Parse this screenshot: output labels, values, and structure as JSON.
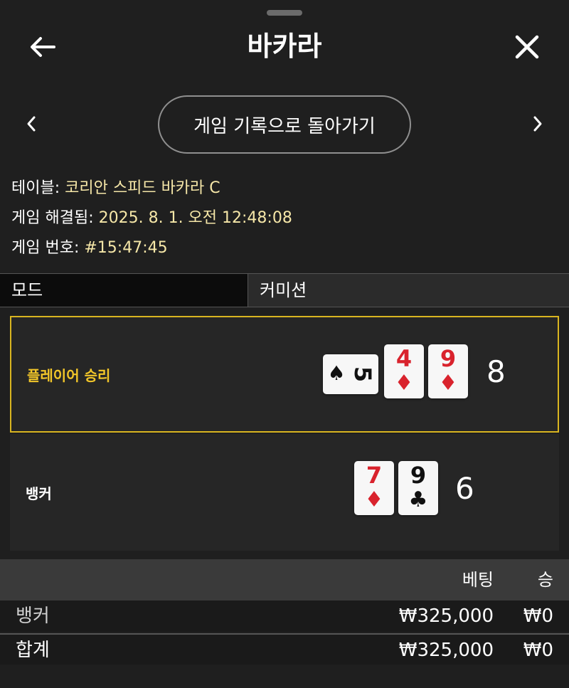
{
  "header": {
    "title": "바카라",
    "back_icon": "arrow-left-icon",
    "close_icon": "close-icon"
  },
  "nav": {
    "back_history_label": "게임 기록으로 돌아가기",
    "prev_icon": "chevron-left-icon",
    "next_icon": "chevron-right-icon"
  },
  "info": {
    "table_label": "테이블:",
    "table_value": "코리안 스피드 바카라 C",
    "resolved_label": "게임 해결됨:",
    "resolved_value": "2025. 8. 1. 오전 12:48:08",
    "game_no_label": "게임 번호:",
    "game_no_value": "#15:47:45"
  },
  "mode": {
    "label": "모드",
    "value": "커미션"
  },
  "results": {
    "player": {
      "label": "플레이어 승리",
      "score": "8",
      "cards": [
        {
          "rank": "5",
          "suit": "♠",
          "color": "black",
          "sideways": true
        },
        {
          "rank": "4",
          "suit": "♦",
          "color": "red",
          "sideways": false
        },
        {
          "rank": "9",
          "suit": "♦",
          "color": "red",
          "sideways": false
        }
      ]
    },
    "banker": {
      "label": "뱅커",
      "score": "6",
      "cards": [
        {
          "rank": "7",
          "suit": "♦",
          "color": "red",
          "sideways": false
        },
        {
          "rank": "9",
          "suit": "♣",
          "color": "black",
          "sideways": false
        }
      ]
    }
  },
  "bets": {
    "col_bet": "베팅",
    "col_win": "승",
    "rows": [
      {
        "name": "뱅커",
        "amount": "₩325,000",
        "win": "₩0"
      },
      {
        "name": "합계",
        "amount": "₩325,000",
        "win": "₩0"
      }
    ]
  },
  "colors": {
    "accent_gold": "#f2c629",
    "info_value": "#f6e7a8",
    "card_red": "#d9232d"
  }
}
